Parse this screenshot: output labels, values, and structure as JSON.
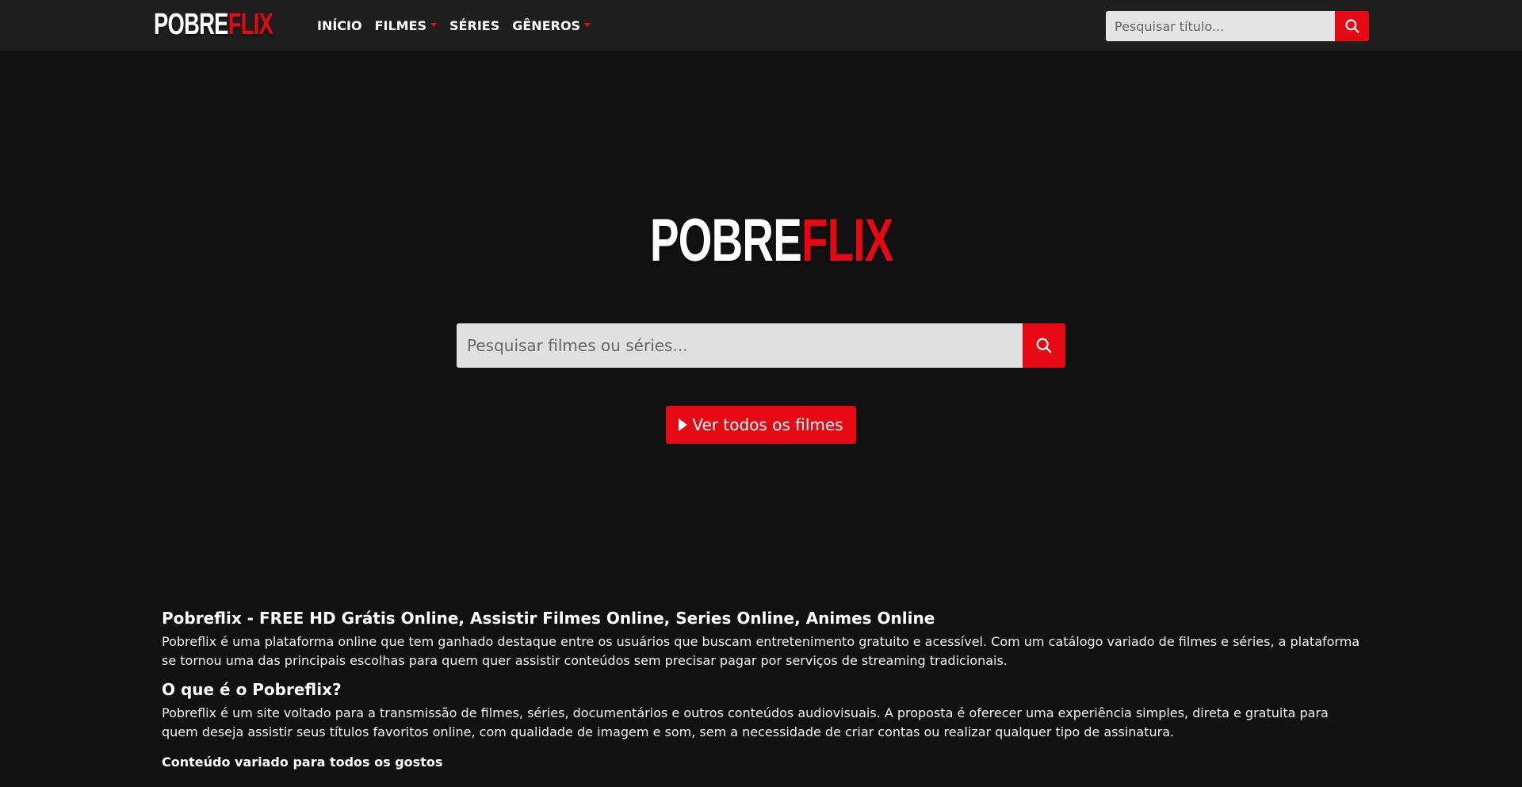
{
  "brand": {
    "part1": "POBRE",
    "part2": "FLIX",
    "accent": "#e50914"
  },
  "nav": {
    "items": [
      {
        "label": "INÍCIO",
        "dropdown": false
      },
      {
        "label": "FILMES",
        "dropdown": true
      },
      {
        "label": "SÉRIES",
        "dropdown": false
      },
      {
        "label": "GÊNEROS",
        "dropdown": true
      }
    ],
    "search": {
      "placeholder": "Pesquisar título..."
    }
  },
  "hero": {
    "search": {
      "placeholder": "Pesquisar filmes ou séries..."
    },
    "cta_label": "Ver todos os filmes"
  },
  "article": {
    "title": "Pobreflix - FREE HD Grátis Online, Assistir Filmes Online, Series Online, Animes Online",
    "intro": "Pobreflix é uma plataforma online que tem ganhado destaque entre os usuários que buscam entretenimento gratuito e acessível. Com um catálogo variado de filmes e séries, a plataforma se tornou uma das principais escolhas para quem quer assistir conteúdos sem precisar pagar por serviços de streaming tradicionais.",
    "section1_title": "O que é o Pobreflix?",
    "section1_text": "Pobreflix é um site voltado para a transmissão de filmes, séries, documentários e outros conteúdos audiovisuais. A proposta é oferecer uma experiência simples, direta e gratuita para quem deseja assistir seus títulos favoritos online, com qualidade de imagem e som, sem a necessidade de criar contas ou realizar qualquer tipo de assinatura.",
    "section2_title": "Conteúdo variado para todos os gostos"
  }
}
